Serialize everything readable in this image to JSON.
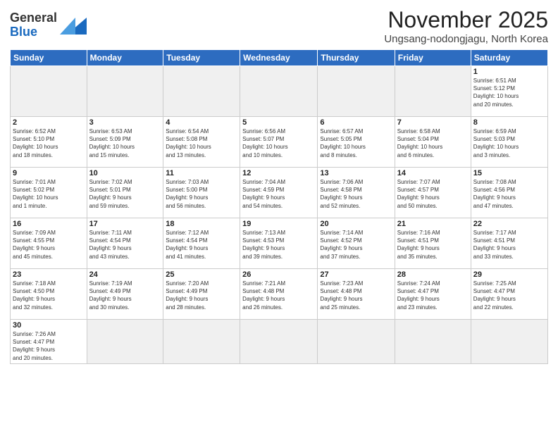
{
  "header": {
    "logo_general": "General",
    "logo_blue": "Blue",
    "month": "November 2025",
    "location": "Ungsang-nodongjagu, North Korea"
  },
  "weekdays": [
    "Sunday",
    "Monday",
    "Tuesday",
    "Wednesday",
    "Thursday",
    "Friday",
    "Saturday"
  ],
  "weeks": [
    [
      {
        "day": "",
        "info": ""
      },
      {
        "day": "",
        "info": ""
      },
      {
        "day": "",
        "info": ""
      },
      {
        "day": "",
        "info": ""
      },
      {
        "day": "",
        "info": ""
      },
      {
        "day": "",
        "info": ""
      },
      {
        "day": "1",
        "info": "Sunrise: 6:51 AM\nSunset: 5:12 PM\nDaylight: 10 hours\nand 20 minutes."
      }
    ],
    [
      {
        "day": "2",
        "info": "Sunrise: 6:52 AM\nSunset: 5:10 PM\nDaylight: 10 hours\nand 18 minutes."
      },
      {
        "day": "3",
        "info": "Sunrise: 6:53 AM\nSunset: 5:09 PM\nDaylight: 10 hours\nand 15 minutes."
      },
      {
        "day": "4",
        "info": "Sunrise: 6:54 AM\nSunset: 5:08 PM\nDaylight: 10 hours\nand 13 minutes."
      },
      {
        "day": "5",
        "info": "Sunrise: 6:56 AM\nSunset: 5:07 PM\nDaylight: 10 hours\nand 10 minutes."
      },
      {
        "day": "6",
        "info": "Sunrise: 6:57 AM\nSunset: 5:05 PM\nDaylight: 10 hours\nand 8 minutes."
      },
      {
        "day": "7",
        "info": "Sunrise: 6:58 AM\nSunset: 5:04 PM\nDaylight: 10 hours\nand 6 minutes."
      },
      {
        "day": "8",
        "info": "Sunrise: 6:59 AM\nSunset: 5:03 PM\nDaylight: 10 hours\nand 3 minutes."
      }
    ],
    [
      {
        "day": "9",
        "info": "Sunrise: 7:01 AM\nSunset: 5:02 PM\nDaylight: 10 hours\nand 1 minute."
      },
      {
        "day": "10",
        "info": "Sunrise: 7:02 AM\nSunset: 5:01 PM\nDaylight: 9 hours\nand 59 minutes."
      },
      {
        "day": "11",
        "info": "Sunrise: 7:03 AM\nSunset: 5:00 PM\nDaylight: 9 hours\nand 56 minutes."
      },
      {
        "day": "12",
        "info": "Sunrise: 7:04 AM\nSunset: 4:59 PM\nDaylight: 9 hours\nand 54 minutes."
      },
      {
        "day": "13",
        "info": "Sunrise: 7:06 AM\nSunset: 4:58 PM\nDaylight: 9 hours\nand 52 minutes."
      },
      {
        "day": "14",
        "info": "Sunrise: 7:07 AM\nSunset: 4:57 PM\nDaylight: 9 hours\nand 50 minutes."
      },
      {
        "day": "15",
        "info": "Sunrise: 7:08 AM\nSunset: 4:56 PM\nDaylight: 9 hours\nand 47 minutes."
      }
    ],
    [
      {
        "day": "16",
        "info": "Sunrise: 7:09 AM\nSunset: 4:55 PM\nDaylight: 9 hours\nand 45 minutes."
      },
      {
        "day": "17",
        "info": "Sunrise: 7:11 AM\nSunset: 4:54 PM\nDaylight: 9 hours\nand 43 minutes."
      },
      {
        "day": "18",
        "info": "Sunrise: 7:12 AM\nSunset: 4:54 PM\nDaylight: 9 hours\nand 41 minutes."
      },
      {
        "day": "19",
        "info": "Sunrise: 7:13 AM\nSunset: 4:53 PM\nDaylight: 9 hours\nand 39 minutes."
      },
      {
        "day": "20",
        "info": "Sunrise: 7:14 AM\nSunset: 4:52 PM\nDaylight: 9 hours\nand 37 minutes."
      },
      {
        "day": "21",
        "info": "Sunrise: 7:16 AM\nSunset: 4:51 PM\nDaylight: 9 hours\nand 35 minutes."
      },
      {
        "day": "22",
        "info": "Sunrise: 7:17 AM\nSunset: 4:51 PM\nDaylight: 9 hours\nand 33 minutes."
      }
    ],
    [
      {
        "day": "23",
        "info": "Sunrise: 7:18 AM\nSunset: 4:50 PM\nDaylight: 9 hours\nand 32 minutes."
      },
      {
        "day": "24",
        "info": "Sunrise: 7:19 AM\nSunset: 4:49 PM\nDaylight: 9 hours\nand 30 minutes."
      },
      {
        "day": "25",
        "info": "Sunrise: 7:20 AM\nSunset: 4:49 PM\nDaylight: 9 hours\nand 28 minutes."
      },
      {
        "day": "26",
        "info": "Sunrise: 7:21 AM\nSunset: 4:48 PM\nDaylight: 9 hours\nand 26 minutes."
      },
      {
        "day": "27",
        "info": "Sunrise: 7:23 AM\nSunset: 4:48 PM\nDaylight: 9 hours\nand 25 minutes."
      },
      {
        "day": "28",
        "info": "Sunrise: 7:24 AM\nSunset: 4:47 PM\nDaylight: 9 hours\nand 23 minutes."
      },
      {
        "day": "29",
        "info": "Sunrise: 7:25 AM\nSunset: 4:47 PM\nDaylight: 9 hours\nand 22 minutes."
      }
    ],
    [
      {
        "day": "30",
        "info": "Sunrise: 7:26 AM\nSunset: 4:47 PM\nDaylight: 9 hours\nand 20 minutes."
      },
      {
        "day": "",
        "info": ""
      },
      {
        "day": "",
        "info": ""
      },
      {
        "day": "",
        "info": ""
      },
      {
        "day": "",
        "info": ""
      },
      {
        "day": "",
        "info": ""
      },
      {
        "day": "",
        "info": ""
      }
    ]
  ]
}
